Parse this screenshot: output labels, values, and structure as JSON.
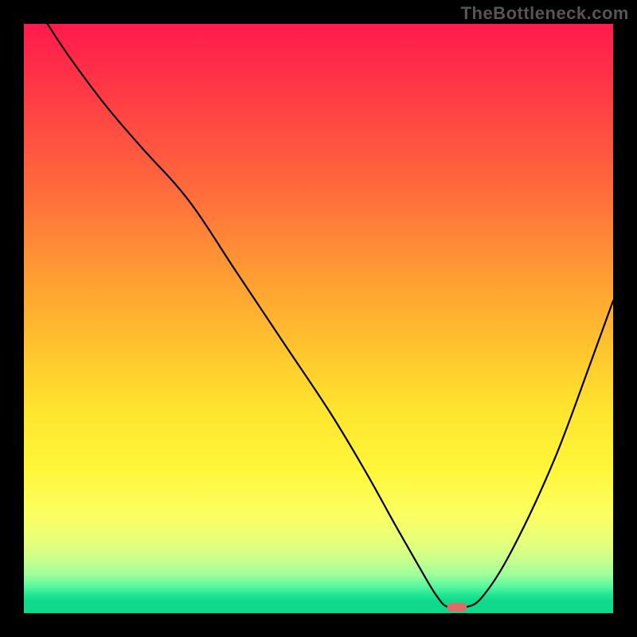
{
  "watermark": "TheBottleneck.com",
  "chart_data": {
    "type": "line",
    "title": "",
    "xlabel": "",
    "ylabel": "",
    "xlim": [
      0,
      100
    ],
    "ylim": [
      0,
      100
    ],
    "grid": false,
    "note": "V-shaped bottleneck curve over a red-to-green vertical gradient. Y-values estimated from pixel positions (0=bottom/green, 100=top/red).",
    "series": [
      {
        "name": "bottleneck-curve",
        "x": [
          4,
          8,
          14,
          20,
          28,
          36,
          44,
          52,
          58,
          63,
          67,
          70,
          72,
          75,
          78,
          83,
          90,
          96,
          100
        ],
        "values": [
          100,
          94,
          86,
          79,
          70,
          58,
          46,
          34,
          24,
          15,
          8,
          3,
          1,
          1,
          3,
          11,
          26,
          42,
          53
        ]
      }
    ],
    "marker": {
      "x": 73.5,
      "y": 1,
      "shape": "pill",
      "color": "#e06a6a"
    },
    "gradient_stops": [
      {
        "pct": 0,
        "color": "#ff1a4c"
      },
      {
        "pct": 28,
        "color": "#ff6a3c"
      },
      {
        "pct": 55,
        "color": "#ffc42e"
      },
      {
        "pct": 76,
        "color": "#fff73a"
      },
      {
        "pct": 91,
        "color": "#c6ff8c"
      },
      {
        "pct": 97,
        "color": "#1de593"
      },
      {
        "pct": 100,
        "color": "#0fd98a"
      }
    ]
  }
}
